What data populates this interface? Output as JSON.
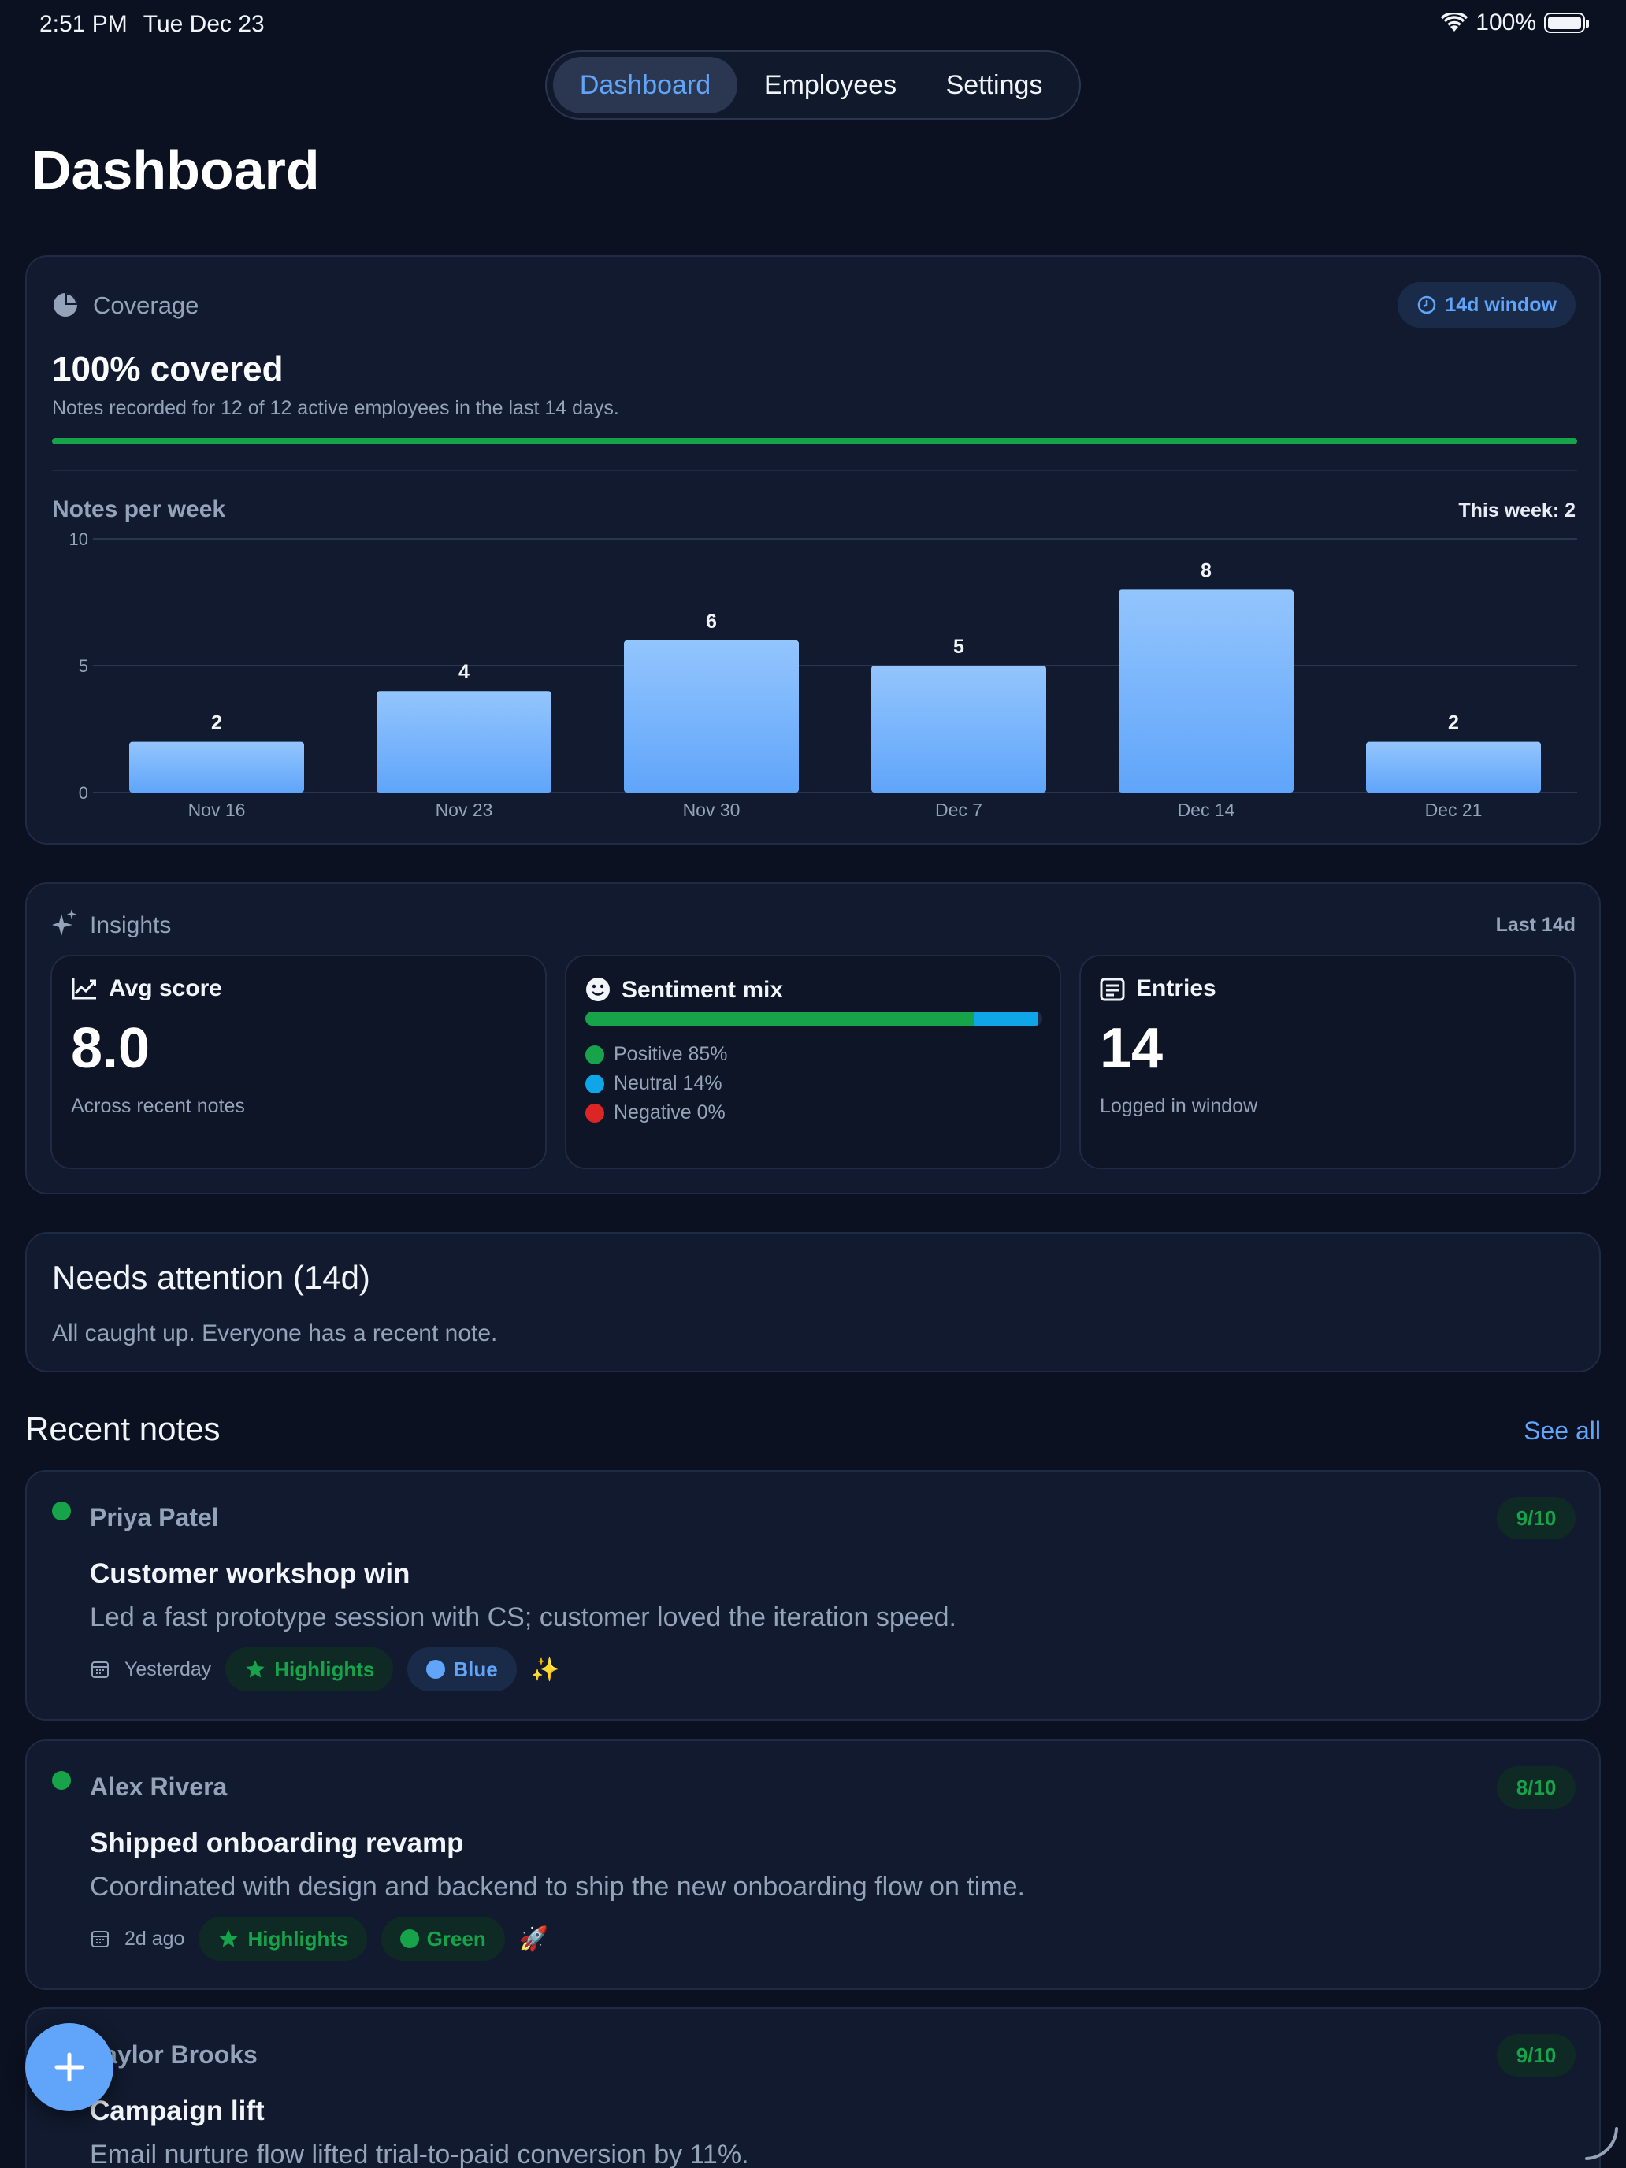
{
  "status_bar": {
    "time": "2:51 PM",
    "date": "Tue Dec 23",
    "battery": "100%"
  },
  "nav": {
    "tabs": [
      {
        "label": "Dashboard",
        "active": true
      },
      {
        "label": "Employees"
      },
      {
        "label": "Settings"
      }
    ]
  },
  "page_title": "Dashboard",
  "coverage": {
    "label": "Coverage",
    "window_badge": "14d window",
    "headline": "100% covered",
    "description": "Notes recorded for 12 of 12 active employees in the last 14 days.",
    "progress": 1.0,
    "progress_color": "#16a34a"
  },
  "notes_per_week": {
    "title": "Notes per week",
    "this_week": "This week: 2"
  },
  "chart_data": {
    "type": "bar",
    "title": "Notes per week",
    "categories": [
      "Nov 16",
      "Nov 23",
      "Nov 30",
      "Dec 7",
      "Dec 14",
      "Dec 21"
    ],
    "values": [
      2,
      4,
      6,
      5,
      8,
      2
    ],
    "ylim": [
      0,
      10
    ],
    "yticks": [
      0,
      5,
      10
    ],
    "grid": true,
    "bar_color": "#60a5fa"
  },
  "insights": {
    "label": "Insights",
    "range": "Last 14d",
    "avg_score": {
      "title": "Avg score",
      "value": "8.0",
      "caption": "Across recent notes"
    },
    "sentiment": {
      "title": "Sentiment mix",
      "items": [
        {
          "label": "Positive 85%",
          "fraction": 0.85,
          "color": "#16a34a"
        },
        {
          "label": "Neutral 14%",
          "fraction": 0.14,
          "color": "#0ea5e9"
        },
        {
          "label": "Negative 0%",
          "fraction": 0.0,
          "color": "#dc2626"
        }
      ]
    },
    "entries": {
      "title": "Entries",
      "value": "14",
      "caption": "Logged in window"
    }
  },
  "needs_attention": {
    "title": "Needs attention (14d)",
    "message": "All caught up. Everyone has a recent note."
  },
  "recent_notes": {
    "title": "Recent notes",
    "see_all": "See all",
    "items": [
      {
        "name": "Priya Patel",
        "score": "9/10",
        "title": "Customer workshop win",
        "body": "Led a fast prototype session with CS; customer loved the iteration speed.",
        "date": "Yesterday",
        "tag": "Highlights",
        "color_tag": "Blue",
        "color_tag_color": "#60a5fa",
        "emoji": "✨"
      },
      {
        "name": "Alex Rivera",
        "score": "8/10",
        "title": "Shipped onboarding revamp",
        "body": "Coordinated with design and backend to ship the new onboarding flow on time.",
        "date": "2d ago",
        "tag": "Highlights",
        "color_tag": "Green",
        "color_tag_color": "#16a34a",
        "emoji": "🚀"
      },
      {
        "name": "Taylor Brooks",
        "score": "9/10",
        "title": "Campaign lift",
        "body": "Email nurture flow lifted trial-to-paid conversion by 11%."
      }
    ]
  },
  "fab": {
    "icon": "plus-icon"
  }
}
